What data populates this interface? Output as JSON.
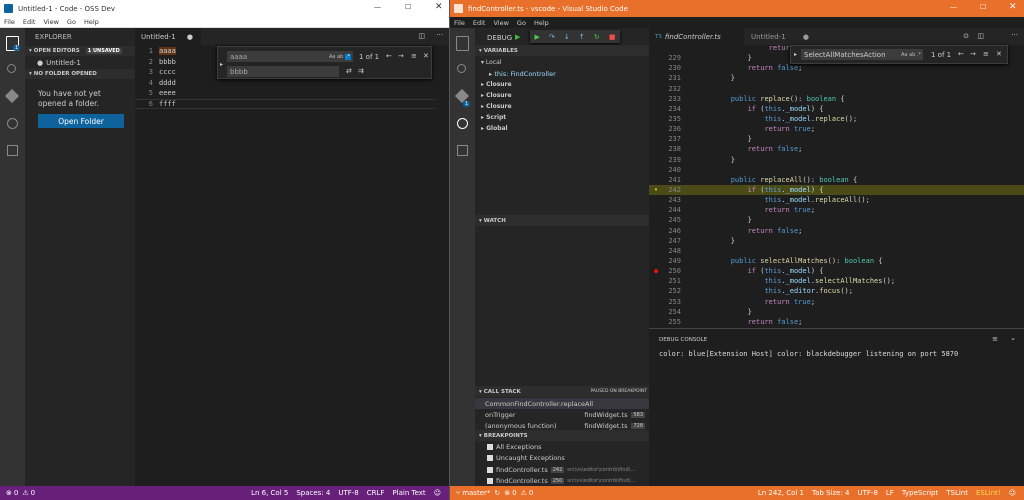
{
  "left": {
    "title": "Untitled-1 - Code - OSS Dev",
    "menu": [
      "File",
      "Edit",
      "View",
      "Go",
      "Help"
    ],
    "explorer": "EXPLORER",
    "open_editors": "OPEN EDITORS",
    "unsaved": "1 UNSAVED",
    "file": "Untitled-1",
    "no_folder": "NO FOLDER OPENED",
    "msg": "You have not yet opened a folder.",
    "open_folder": "Open Folder",
    "tab": "Untitled-1",
    "lines": [
      "aaaa",
      "bbbb",
      "cccc",
      "dddd",
      "eeee",
      "ffff"
    ],
    "find_value": "aaaa",
    "replace_value": "bbbb",
    "find_count": "1 of 1",
    "status": {
      "errors": "0",
      "warnings": "0",
      "pos": "Ln 6, Col 5",
      "spaces": "Spaces: 4",
      "enc": "UTF-8",
      "eol": "CRLF",
      "lang": "Plain Text"
    },
    "activity_badge": "1"
  },
  "right": {
    "title": "findController.ts - vscode - Visual Studio Code",
    "menu": [
      "File",
      "Edit",
      "View",
      "Go",
      "Help"
    ],
    "debug_label": "DEBUG",
    "variables": "VARIABLES",
    "local": "Local",
    "this_var": "this: FindController",
    "closures": [
      "Closure",
      "Closure",
      "Closure",
      "Script",
      "Global"
    ],
    "watch": "WATCH",
    "call_stack": "CALL STACK",
    "paused": "PAUSED ON BREAKPOINT",
    "frames": [
      {
        "name": "CommonFindController.replaceAll",
        "file": "",
        "line": ""
      },
      {
        "name": "onTrigger",
        "file": "findWidget.ts",
        "line": "583"
      },
      {
        "name": "(anonymous function)",
        "file": "findWidget.ts",
        "line": "728"
      }
    ],
    "breakpoints_title": "BREAKPOINTS",
    "breakpoints": [
      {
        "label": "All Exceptions",
        "line": "",
        "path": ""
      },
      {
        "label": "Uncaught Exceptions",
        "line": "",
        "path": ""
      },
      {
        "label": "findController.ts",
        "line": "242",
        "path": "src\\vs\\editor\\contrib\\find\\..."
      },
      {
        "label": "findController.ts",
        "line": "250",
        "path": "src\\vs\\editor\\contrib\\find\\..."
      }
    ],
    "tabs": [
      "findController.ts",
      "Untitled-1"
    ],
    "find_value": "SelectAllMatchesAction",
    "find_count": "1 of 1",
    "line_numbers": [
      "229",
      "230",
      "231",
      "232",
      "233",
      "234",
      "235",
      "236",
      "237",
      "238",
      "239",
      "240",
      "241",
      "242",
      "243",
      "244",
      "245",
      "246",
      "247",
      "248",
      "249",
      "250",
      "251",
      "252",
      "253",
      "254",
      "255"
    ],
    "debug_console": "DEBUG CONSOLE",
    "console_output": "color: blue[Extension Host] color: blackdebugger listening on port 5870",
    "status": {
      "branch": "master*",
      "errors": "0",
      "warnings": "0",
      "pos": "Ln 242, Col 1",
      "tab": "Tab Size: 4",
      "enc": "UTF-8",
      "eol": "LF",
      "lang": "TypeScript",
      "lint": "TSLint",
      "eslint": "ESLint!"
    },
    "activity_badge": "1"
  }
}
